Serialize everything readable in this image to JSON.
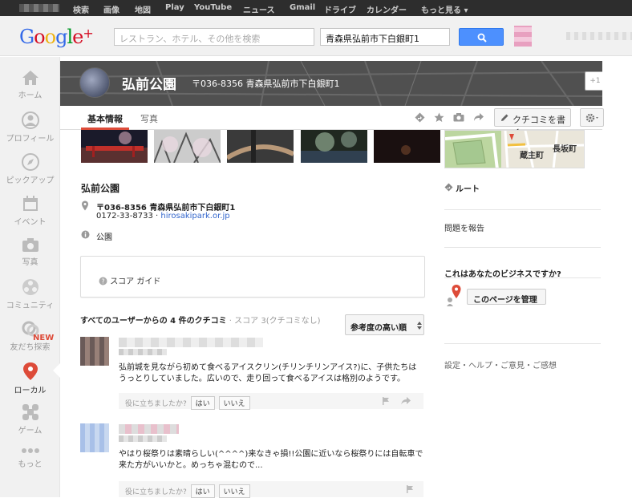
{
  "topbar": {
    "links": [
      "検索",
      "画像",
      "地図",
      "Play",
      "YouTube",
      "ニュース",
      "Gmail",
      "ドライブ",
      "カレンダー",
      "もっと見る ▾"
    ]
  },
  "header": {
    "logo_text": "Google",
    "logo_plus": "+",
    "search_placeholder": "レストラン、ホテル、その他を検索",
    "location_value": "青森県弘前市下白銀町1"
  },
  "sidebar": {
    "items": [
      {
        "label": "ホーム",
        "icon": "home-icon"
      },
      {
        "label": "プロフィール",
        "icon": "profile-icon"
      },
      {
        "label": "ピックアップ",
        "icon": "compass-icon"
      },
      {
        "label": "イベント",
        "icon": "calendar-icon"
      },
      {
        "label": "写真",
        "icon": "camera-icon"
      },
      {
        "label": "コミュニティ",
        "icon": "community-icon"
      },
      {
        "label": "友だち探索",
        "icon": "friends-icon"
      },
      {
        "label": "ローカル",
        "icon": "local-pin-icon"
      },
      {
        "label": "ゲーム",
        "icon": "game-icon"
      },
      {
        "label": "もっと",
        "icon": "more-icon"
      }
    ],
    "new_badge": "NEW"
  },
  "place": {
    "name": "弘前公園",
    "address_header": "〒036-8356 青森県弘前市下白銀町1",
    "plusone": "+1"
  },
  "tabs": {
    "basic": "基本情報",
    "photos": "写真",
    "write_review": "クチコミを書く"
  },
  "info": {
    "title": "弘前公園",
    "address": "〒036-8356 青森県弘前市下白銀町1",
    "phone": "0172-33-8733",
    "separator": " · ",
    "website": "hirosakipark.or.jp",
    "category": "公園"
  },
  "score": {
    "label": "スコア ガイド"
  },
  "reviews": {
    "heading": "すべてのユーザーからの 4 件のクチコミ",
    "heading_sub": " · スコア 3(クチコミなし)",
    "sort_label": "参考度の高い順",
    "helpful_prompt": "役に立ちましたか?",
    "yes": "はい",
    "no": "いいえ",
    "items": [
      {
        "text": "弘前城を見ながら初めて食べるアイスクリン(チリンチリンアイス?)に、子供たちはうっとりしていました。広いので、走り回って食べるアイスは格別のようです。"
      },
      {
        "text": "やはり桜祭りは素晴らしい(^^^^)来なきゃ損!!公園に近いなら桜祭りには自転車で来た方がいいかと。めっちゃ混むので..."
      }
    ]
  },
  "right": {
    "route": "ルート",
    "report": "問題を報告",
    "biz_question": "これはあなたのビジネスですか?",
    "manage": "このページを管理",
    "footer": "設定・ヘルプ・ご意見・ご感想",
    "map_labels": [
      "蔵主町",
      "長坂町"
    ]
  },
  "colors": {
    "accent_red": "#dd4b39",
    "search_blue": "#4d90fe",
    "link_blue": "#3366cc"
  }
}
